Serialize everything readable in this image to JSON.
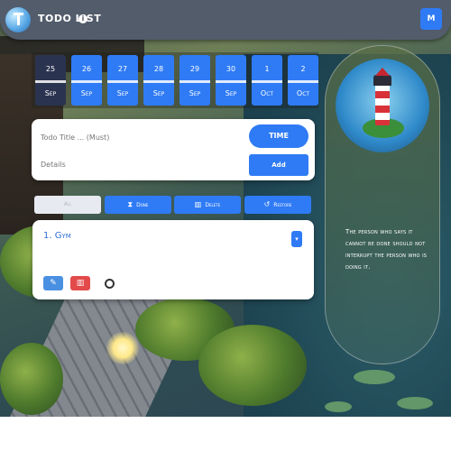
{
  "header": {
    "title": "TODO LIST",
    "info_icon": "info-icon",
    "menu_label": "M"
  },
  "dates": [
    {
      "day": "25",
      "month": "Sep",
      "active": true
    },
    {
      "day": "26",
      "month": "Sep",
      "active": false
    },
    {
      "day": "27",
      "month": "Sep",
      "active": false
    },
    {
      "day": "28",
      "month": "Sep",
      "active": false
    },
    {
      "day": "29",
      "month": "Sep",
      "active": false
    },
    {
      "day": "30",
      "month": "Sep",
      "active": false
    },
    {
      "day": "1",
      "month": "Oct",
      "active": false
    },
    {
      "day": "2",
      "month": "Oct",
      "active": false
    }
  ],
  "form": {
    "task_placeholder": "Todo Title ... (Must)",
    "detail_placeholder": "Details",
    "time_label": "TIME",
    "add_label": "Add"
  },
  "tabs": [
    {
      "label": "All",
      "icon": "list-icon"
    },
    {
      "label": "Done",
      "icon": "hourglass-icon"
    },
    {
      "label": "Delete",
      "icon": "trash-icon"
    },
    {
      "label": "Restore",
      "icon": "history-icon"
    }
  ],
  "tasks": [
    {
      "title": "1. Gym"
    }
  ],
  "quote": {
    "text": "The person who says it cannot be done should not interrupt the person who is doing it."
  },
  "colors": {
    "accent": "#2f7bf5",
    "header": "#525c6b",
    "danger": "#e34a4a"
  }
}
